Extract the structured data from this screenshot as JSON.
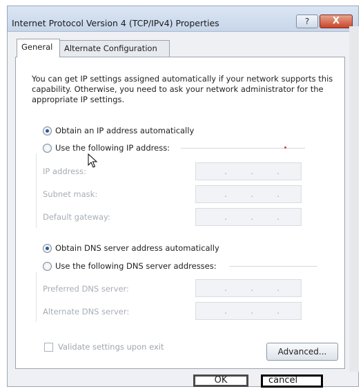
{
  "window": {
    "title": "Internet Protocol Version 4 (TCP/IPv4) Properties",
    "help_label": "?",
    "close_label": "X"
  },
  "tabs": [
    {
      "label": "General",
      "active": true
    },
    {
      "label": "Alternate Configuration",
      "active": false
    }
  ],
  "intro_text": "You can get IP settings assigned automatically if your network supports this capability. Otherwise, you need to ask your network administrator for the appropriate IP settings.",
  "ip_group": {
    "auto_label": "Obtain an IP address automatically",
    "manual_label": "Use the following IP address:",
    "selected": "auto",
    "fields": [
      {
        "label": "IP address:"
      },
      {
        "label": "Subnet mask:"
      },
      {
        "label": "Default gateway:"
      }
    ]
  },
  "dns_group": {
    "auto_label": "Obtain DNS server address automatically",
    "manual_label": "Use the following DNS server addresses:",
    "selected": "auto",
    "fields": [
      {
        "label": "Preferred DNS server:"
      },
      {
        "label": "Alternate DNS server:"
      }
    ]
  },
  "validate_label": "Validate settings upon exit",
  "advanced_label": "Advanced...",
  "ok_label": "OK",
  "cancel_label": "cancel",
  "ip_dot": ".",
  "colors": {
    "title_bar": "#c7d6ea",
    "close_button": "#c8452a",
    "radio_selected": "#2b5797",
    "disabled_text": "#a7adb5"
  }
}
